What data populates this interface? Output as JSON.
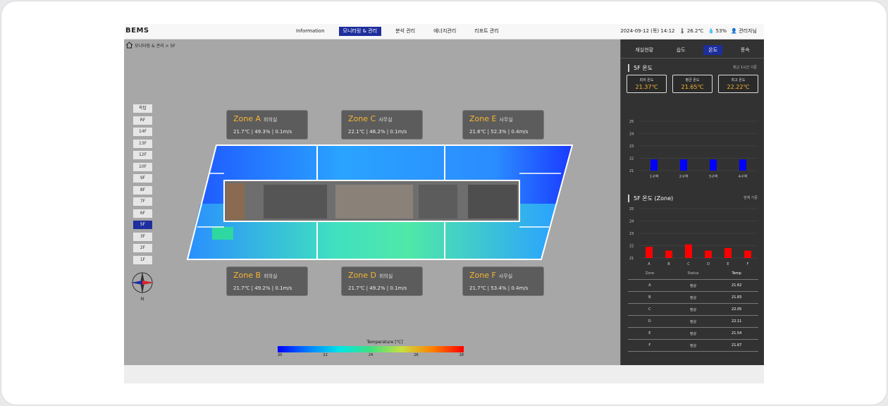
{
  "app": {
    "logo": "BEMS"
  },
  "nav": [
    {
      "label": "Information",
      "active": false
    },
    {
      "label": "모니터링 & 관리",
      "active": true
    },
    {
      "label": "분석 관리",
      "active": false
    },
    {
      "label": "에너지관리",
      "active": false
    },
    {
      "label": "리포트 관리",
      "active": false
    }
  ],
  "top_right": {
    "datetime": "2024-09-12 (목) 14:12",
    "weather": "26.2℃",
    "humidity": "53%",
    "user": "관리자님"
  },
  "breadcrumb": {
    "text": "모니터링 & 관리 > 5F"
  },
  "floors": [
    {
      "label": "옥탑",
      "active": false
    },
    {
      "label": "RF",
      "active": false
    },
    {
      "label": "14F",
      "active": false
    },
    {
      "label": "13F",
      "active": false
    },
    {
      "label": "12F",
      "active": false
    },
    {
      "label": "10F",
      "active": false
    },
    {
      "label": "9F",
      "active": false
    },
    {
      "label": "8F",
      "active": false
    },
    {
      "label": "7F",
      "active": false
    },
    {
      "label": "6F",
      "active": false
    },
    {
      "label": "5F",
      "active": true
    },
    {
      "label": "3F",
      "active": false
    },
    {
      "label": "2F",
      "active": false
    },
    {
      "label": "1F",
      "active": false
    }
  ],
  "zones": [
    {
      "name": "Zone A",
      "sub": "회의실",
      "temp": "21.7℃",
      "hum": "49.3%",
      "wind": "0.1m/s"
    },
    {
      "name": "Zone C",
      "sub": "사무실",
      "temp": "22.1℃",
      "hum": "46.2%",
      "wind": "0.1m/s"
    },
    {
      "name": "Zone E",
      "sub": "사무실",
      "temp": "21.6℃",
      "hum": "52.3%",
      "wind": "0.4m/s"
    },
    {
      "name": "Zone B",
      "sub": "회의실",
      "temp": "21.7℃",
      "hum": "49.2%",
      "wind": "0.1m/s"
    },
    {
      "name": "Zone D",
      "sub": "회의실",
      "temp": "21.7℃",
      "hum": "49.2%",
      "wind": "0.1m/s"
    },
    {
      "name": "Zone F",
      "sub": "사무실",
      "temp": "21.7℃",
      "hum": "53.4%",
      "wind": "0.4m/s"
    }
  ],
  "legend": {
    "title": "Temperature [℃]",
    "ticks": [
      "20",
      "22",
      "24",
      "26",
      "28"
    ]
  },
  "panel": {
    "tabs": [
      {
        "label": "재실현황",
        "active": false
      },
      {
        "label": "습도",
        "active": false
      },
      {
        "label": "온도",
        "active": true
      },
      {
        "label": "풍속",
        "active": false
      }
    ],
    "section1": {
      "title": "5F 온도",
      "right": "최근 1시간 기준"
    },
    "stats": [
      {
        "label": "최저 온도",
        "value": "21.37℃"
      },
      {
        "label": "평균 온도",
        "value": "21.65℃"
      },
      {
        "label": "최고 온도",
        "value": "22.22℃"
      }
    ],
    "section2": {
      "title": "5F 온도 (Zone)",
      "right": "현재 기준"
    },
    "table": {
      "headers": [
        "Zone",
        "Status",
        "Temp"
      ],
      "rows": [
        [
          "A",
          "정상",
          "21.62"
        ],
        [
          "B",
          "정상",
          "21.83"
        ],
        [
          "C",
          "정상",
          "22.05"
        ],
        [
          "D",
          "정상",
          "22.11"
        ],
        [
          "E",
          "정상",
          "21.54"
        ],
        [
          "F",
          "정상",
          "21.67"
        ]
      ]
    }
  },
  "chart_data": [
    {
      "type": "bar",
      "title": "5F 온도",
      "categories": [
        "1구역",
        "2구역",
        "3구역",
        "4구역"
      ],
      "values": [
        21.9,
        21.9,
        21.9,
        21.9
      ],
      "yticks": [
        "25",
        "24",
        "23",
        "22",
        "21"
      ],
      "ylim": [
        21,
        25
      ],
      "color": "#0000ff"
    },
    {
      "type": "bar",
      "title": "5F 온도 (Zone)",
      "categories": [
        "A",
        "B",
        "C",
        "D",
        "E",
        "F"
      ],
      "values": [
        21.9,
        21.6,
        22.1,
        21.6,
        21.8,
        21.6
      ],
      "yticks": [
        "25",
        "24",
        "23",
        "22",
        "21"
      ],
      "ylim": [
        21,
        25
      ],
      "color": "#ff0000"
    }
  ]
}
